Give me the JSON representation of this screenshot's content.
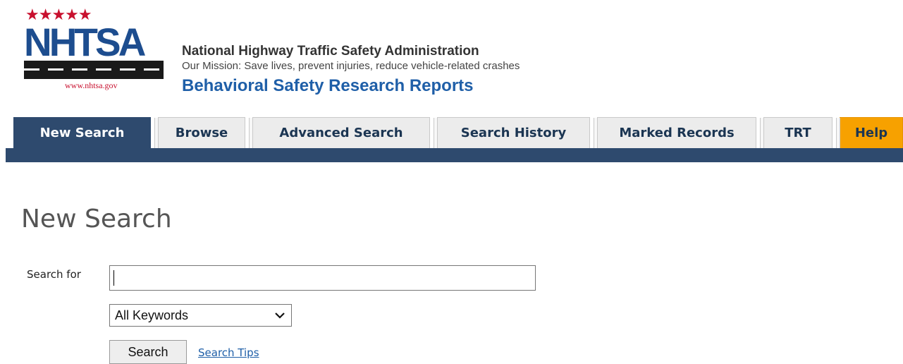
{
  "logo": {
    "stars": "★★★★★",
    "wordmark": "NHTSA",
    "url_text": "www.nhtsa.gov"
  },
  "header": {
    "agency": "National Highway Traffic Safety Administration",
    "mission": "Our Mission: Save lives, prevent injuries, reduce vehicle-related crashes",
    "site_title": "Behavioral Safety Research Reports"
  },
  "tabs": [
    {
      "label": "New Search",
      "active": true
    },
    {
      "label": "Browse",
      "active": false
    },
    {
      "label": "Advanced Search",
      "active": false
    },
    {
      "label": "Search History",
      "active": false
    },
    {
      "label": "Marked Records",
      "active": false
    },
    {
      "label": "TRT",
      "active": false
    },
    {
      "label": "Help",
      "active": false
    }
  ],
  "main": {
    "title": "New Search",
    "search_label": "Search for",
    "search_value": "",
    "select_value": "All Keywords",
    "search_button": "Search",
    "tips_link": "Search Tips"
  },
  "colors": {
    "nav": "#2e4a6e",
    "help_tab": "#f7a100",
    "brand_blue": "#1d4d8f",
    "link": "#1f5fa8"
  }
}
